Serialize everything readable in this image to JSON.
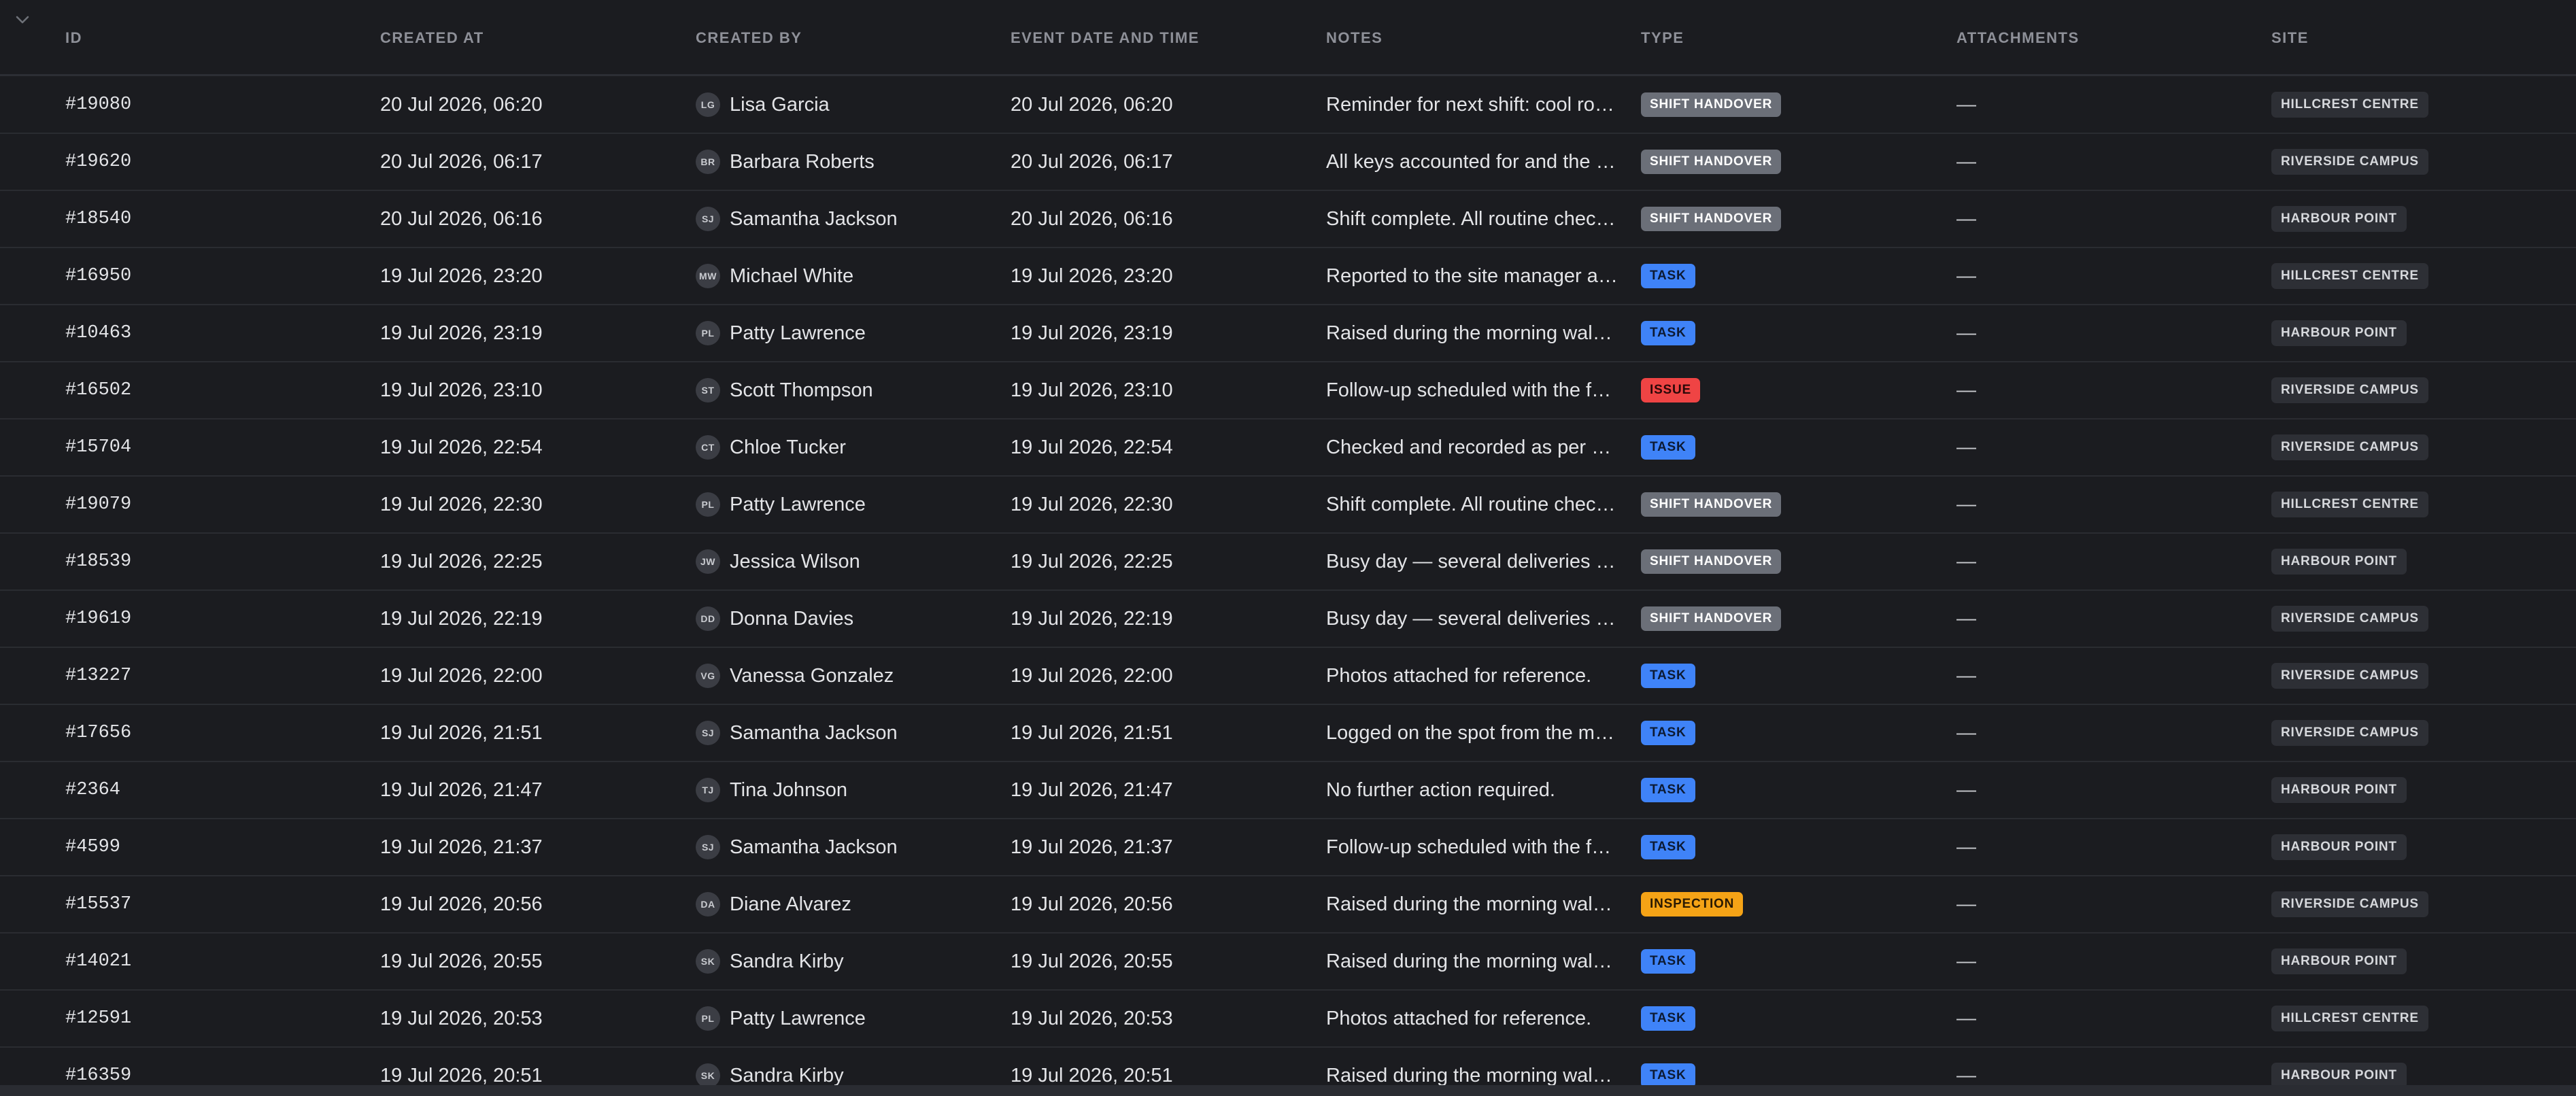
{
  "table": {
    "columns": {
      "id": "ID",
      "created_at": "CREATED AT",
      "created_by": "CREATED BY",
      "event_date": "EVENT DATE AND TIME",
      "notes": "NOTES",
      "type": "TYPE",
      "attachments": "ATTACHMENTS",
      "site": "SITE"
    },
    "rows": [
      {
        "id": "#19080",
        "created_at": "20 Jul 2026, 06:20",
        "initials": "LG",
        "name": "Lisa Garcia",
        "event": "20 Jul 2026, 06:20",
        "notes": "Reminder for next shift: cool room temperature",
        "type": "SHIFT HANDOVER",
        "type_key": "handover",
        "attachments": "—",
        "site": "HILLCREST CENTRE"
      },
      {
        "id": "#19620",
        "created_at": "20 Jul 2026, 06:17",
        "initials": "BR",
        "name": "Barbara Roberts",
        "event": "20 Jul 2026, 06:17",
        "notes": "All keys accounted for and the site secured",
        "type": "SHIFT HANDOVER",
        "type_key": "handover",
        "attachments": "—",
        "site": "RIVERSIDE CAMPUS"
      },
      {
        "id": "#18540",
        "created_at": "20 Jul 2026, 06:16",
        "initials": "SJ",
        "name": "Samantha Jackson",
        "event": "20 Jul 2026, 06:16",
        "notes": "Shift complete. All routine checks done",
        "type": "SHIFT HANDOVER",
        "type_key": "handover",
        "attachments": "—",
        "site": "HARBOUR POINT"
      },
      {
        "id": "#16950",
        "created_at": "19 Jul 2026, 23:20",
        "initials": "MW",
        "name": "Michael White",
        "event": "19 Jul 2026, 23:20",
        "notes": "Reported to the site manager and logged",
        "type": "TASK",
        "type_key": "task",
        "attachments": "—",
        "site": "HILLCREST CENTRE"
      },
      {
        "id": "#10463",
        "created_at": "19 Jul 2026, 23:19",
        "initials": "PL",
        "name": "Patty Lawrence",
        "event": "19 Jul 2026, 23:19",
        "notes": "Raised during the morning walkthrough",
        "type": "TASK",
        "type_key": "task",
        "attachments": "—",
        "site": "HARBOUR POINT"
      },
      {
        "id": "#16502",
        "created_at": "19 Jul 2026, 23:10",
        "initials": "ST",
        "name": "Scott Thompson",
        "event": "19 Jul 2026, 23:10",
        "notes": "Follow-up scheduled with the facilities team",
        "type": "ISSUE",
        "type_key": "issue",
        "attachments": "—",
        "site": "RIVERSIDE CAMPUS"
      },
      {
        "id": "#15704",
        "created_at": "19 Jul 2026, 22:54",
        "initials": "CT",
        "name": "Chloe Tucker",
        "event": "19 Jul 2026, 22:54",
        "notes": "Checked and recorded as per site procedure",
        "type": "TASK",
        "type_key": "task",
        "attachments": "—",
        "site": "RIVERSIDE CAMPUS"
      },
      {
        "id": "#19079",
        "created_at": "19 Jul 2026, 22:30",
        "initials": "PL",
        "name": "Patty Lawrence",
        "event": "19 Jul 2026, 22:30",
        "notes": "Shift complete. All routine checks done",
        "type": "SHIFT HANDOVER",
        "type_key": "handover",
        "attachments": "—",
        "site": "HILLCREST CENTRE"
      },
      {
        "id": "#18539",
        "created_at": "19 Jul 2026, 22:25",
        "initials": "JW",
        "name": "Jessica Wilson",
        "event": "19 Jul 2026, 22:25",
        "notes": "Busy day — several deliveries and visitors",
        "type": "SHIFT HANDOVER",
        "type_key": "handover",
        "attachments": "—",
        "site": "HARBOUR POINT"
      },
      {
        "id": "#19619",
        "created_at": "19 Jul 2026, 22:19",
        "initials": "DD",
        "name": "Donna Davies",
        "event": "19 Jul 2026, 22:19",
        "notes": "Busy day — several deliveries and visitors",
        "type": "SHIFT HANDOVER",
        "type_key": "handover",
        "attachments": "—",
        "site": "RIVERSIDE CAMPUS"
      },
      {
        "id": "#13227",
        "created_at": "19 Jul 2026, 22:00",
        "initials": "VG",
        "name": "Vanessa Gonzalez",
        "event": "19 Jul 2026, 22:00",
        "notes": "Photos attached for reference.",
        "type": "TASK",
        "type_key": "task",
        "attachments": "—",
        "site": "RIVERSIDE CAMPUS"
      },
      {
        "id": "#17656",
        "created_at": "19 Jul 2026, 21:51",
        "initials": "SJ",
        "name": "Samantha Jackson",
        "event": "19 Jul 2026, 21:51",
        "notes": "Logged on the spot from the mobile app",
        "type": "TASK",
        "type_key": "task",
        "attachments": "—",
        "site": "RIVERSIDE CAMPUS"
      },
      {
        "id": "#2364",
        "created_at": "19 Jul 2026, 21:47",
        "initials": "TJ",
        "name": "Tina Johnson",
        "event": "19 Jul 2026, 21:47",
        "notes": "No further action required.",
        "type": "TASK",
        "type_key": "task",
        "attachments": "—",
        "site": "HARBOUR POINT"
      },
      {
        "id": "#4599",
        "created_at": "19 Jul 2026, 21:37",
        "initials": "SJ",
        "name": "Samantha Jackson",
        "event": "19 Jul 2026, 21:37",
        "notes": "Follow-up scheduled with the facilities team",
        "type": "TASK",
        "type_key": "task",
        "attachments": "—",
        "site": "HARBOUR POINT"
      },
      {
        "id": "#15537",
        "created_at": "19 Jul 2026, 20:56",
        "initials": "DA",
        "name": "Diane Alvarez",
        "event": "19 Jul 2026, 20:56",
        "notes": "Raised during the morning walkthrough",
        "type": "INSPECTION",
        "type_key": "inspection",
        "attachments": "—",
        "site": "RIVERSIDE CAMPUS"
      },
      {
        "id": "#14021",
        "created_at": "19 Jul 2026, 20:55",
        "initials": "SK",
        "name": "Sandra Kirby",
        "event": "19 Jul 2026, 20:55",
        "notes": "Raised during the morning walkthrough",
        "type": "TASK",
        "type_key": "task",
        "attachments": "—",
        "site": "HARBOUR POINT"
      },
      {
        "id": "#12591",
        "created_at": "19 Jul 2026, 20:53",
        "initials": "PL",
        "name": "Patty Lawrence",
        "event": "19 Jul 2026, 20:53",
        "notes": "Photos attached for reference.",
        "type": "TASK",
        "type_key": "task",
        "attachments": "—",
        "site": "HILLCREST CENTRE"
      },
      {
        "id": "#16359",
        "created_at": "19 Jul 2026, 20:51",
        "initials": "SK",
        "name": "Sandra Kirby",
        "event": "19 Jul 2026, 20:51",
        "notes": "Raised during the morning walkthrough",
        "type": "TASK",
        "type_key": "task",
        "attachments": "—",
        "site": "HARBOUR POINT"
      }
    ]
  },
  "type_colors": {
    "handover": {
      "bg": "#6b6f78",
      "fg": "#ffffff"
    },
    "task": {
      "bg": "#3f83f8",
      "fg": "#0c1a33"
    },
    "issue": {
      "bg": "#ef4444",
      "fg": "#2a0808"
    },
    "inspection": {
      "bg": "#f5a316",
      "fg": "#2a1a02"
    }
  },
  "icons": {
    "collapse": "chevron-down-icon"
  }
}
